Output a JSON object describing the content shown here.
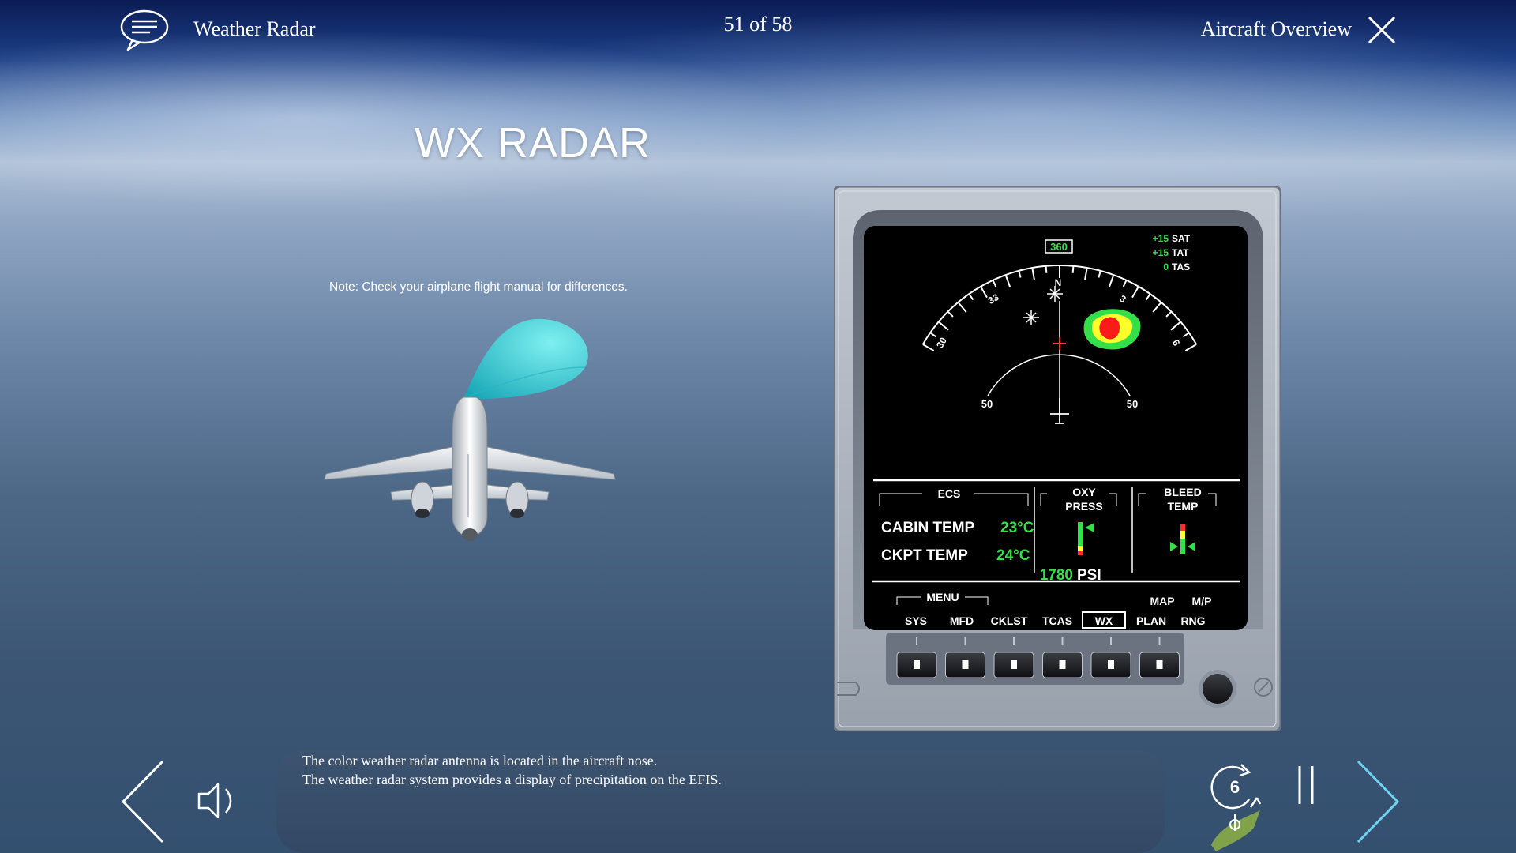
{
  "header": {
    "module_title": "Weather Radar",
    "page_counter": "51 of 58",
    "section_title": "Aircraft Overview"
  },
  "slide": {
    "title": "WX RADAR",
    "note": "Note: Check your airplane flight manual for differences."
  },
  "efis": {
    "heading_box": "360",
    "sat_value": "+15",
    "sat_label": "SAT",
    "tat_value": "+15",
    "tat_label": "TAT",
    "tas_value": "0",
    "tas_label": "TAS",
    "compass_labels": [
      "N",
      "3",
      "6",
      "33",
      "30"
    ],
    "range_left": "50",
    "range_right": "50",
    "ecs_title": "ECS",
    "cabin_temp_label": "CABIN TEMP",
    "cabin_temp_value": "23°C",
    "ckpt_temp_label": "CKPT TEMP",
    "ckpt_temp_value": "24°C",
    "oxy_title_1": "OXY",
    "oxy_title_2": "PRESS",
    "oxy_value": "1780",
    "oxy_unit": "PSI",
    "bleed_title_1": "BLEED",
    "bleed_title_2": "TEMP",
    "menu_label": "MENU",
    "map_label": "MAP",
    "mp_label": "M/P",
    "softkeys": [
      "SYS",
      "MFD",
      "CKLST",
      "TCAS",
      "WX",
      "PLAN",
      "RNG"
    ],
    "selected_softkey": "WX",
    "colors": {
      "green": "#33e04a",
      "white": "#ffffff",
      "bezel": "#aab2bf",
      "screen": "#000000"
    }
  },
  "narration": {
    "line1": "The color weather radar antenna is located in the aircraft nose.",
    "line2": "The weather radar system provides a display of precipitation on the EFIS."
  },
  "controls": {
    "replay_count": "6",
    "icons": [
      "chat-icon",
      "close-icon",
      "prev-arrow-icon",
      "speaker-icon",
      "replay-icon",
      "pause-icon",
      "next-arrow-icon"
    ]
  }
}
